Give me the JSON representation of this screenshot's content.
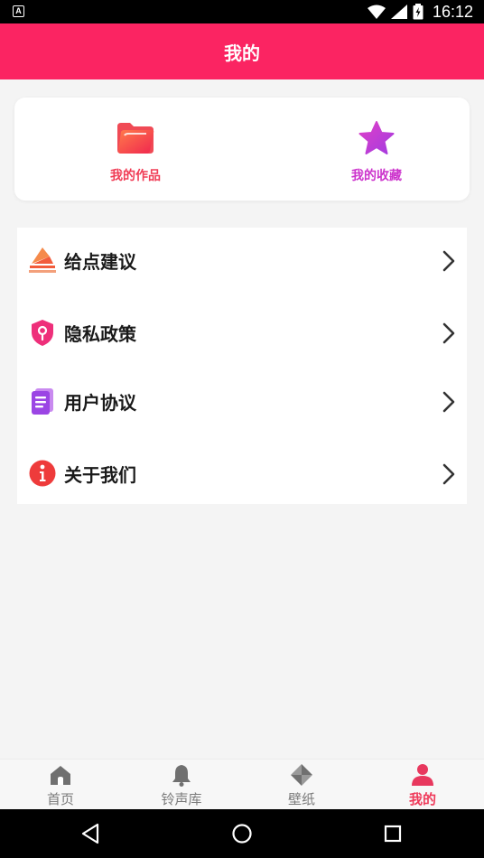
{
  "status_bar": {
    "time": "16:12",
    "left_badge": "A",
    "icons": [
      "wifi-icon",
      "signal-icon",
      "battery-icon"
    ]
  },
  "app_bar": {
    "title": "我的"
  },
  "quick_actions": [
    {
      "label": "我的作品",
      "icon": "folder-icon",
      "color": "#f03c55"
    },
    {
      "label": "我的收藏",
      "icon": "star-icon",
      "color": "#cc33cc"
    }
  ],
  "menu": [
    {
      "label": "给点建议",
      "icon": "feedback-icon"
    },
    {
      "label": "隐私政策",
      "icon": "shield-icon"
    },
    {
      "label": "用户协议",
      "icon": "document-icon"
    },
    {
      "label": "关于我们",
      "icon": "info-icon"
    }
  ],
  "tabs": [
    {
      "label": "首页",
      "icon": "home-icon",
      "active": false
    },
    {
      "label": "铃声库",
      "icon": "bell-icon",
      "active": false
    },
    {
      "label": "壁纸",
      "icon": "wallpaper-icon",
      "active": false
    },
    {
      "label": "我的",
      "icon": "person-icon",
      "active": true
    }
  ],
  "colors": {
    "accent": "#fb2462",
    "active_tab": "#ef3a5a",
    "background": "#f4f4f4"
  }
}
